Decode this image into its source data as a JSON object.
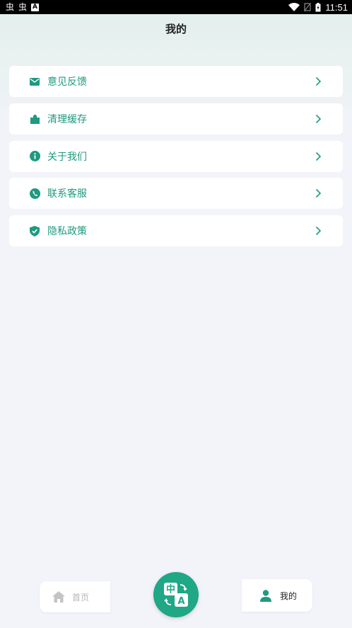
{
  "status_bar": {
    "left_icons": [
      "notification-icon",
      "notification-icon",
      "accessibility-icon"
    ],
    "glyph_1": "虫",
    "glyph_2": "虫",
    "box_letter": "A",
    "time": "11:51"
  },
  "header": {
    "title": "我的"
  },
  "menu": {
    "items": [
      {
        "label": "意见反馈",
        "icon": "mail-icon"
      },
      {
        "label": "清理缓存",
        "icon": "puzzle-icon"
      },
      {
        "label": "关于我们",
        "icon": "info-icon"
      },
      {
        "label": "联系客服",
        "icon": "phone-icon"
      },
      {
        "label": "隐私政策",
        "icon": "shield-check-icon"
      }
    ]
  },
  "tabbar": {
    "home_label": "首页",
    "mine_label": "我的",
    "fab_top_text": "中",
    "fab_bottom_text": "A"
  },
  "colors": {
    "accent": "#1e9a80",
    "fab": "#1fa786",
    "background": "#f3f3fa"
  }
}
